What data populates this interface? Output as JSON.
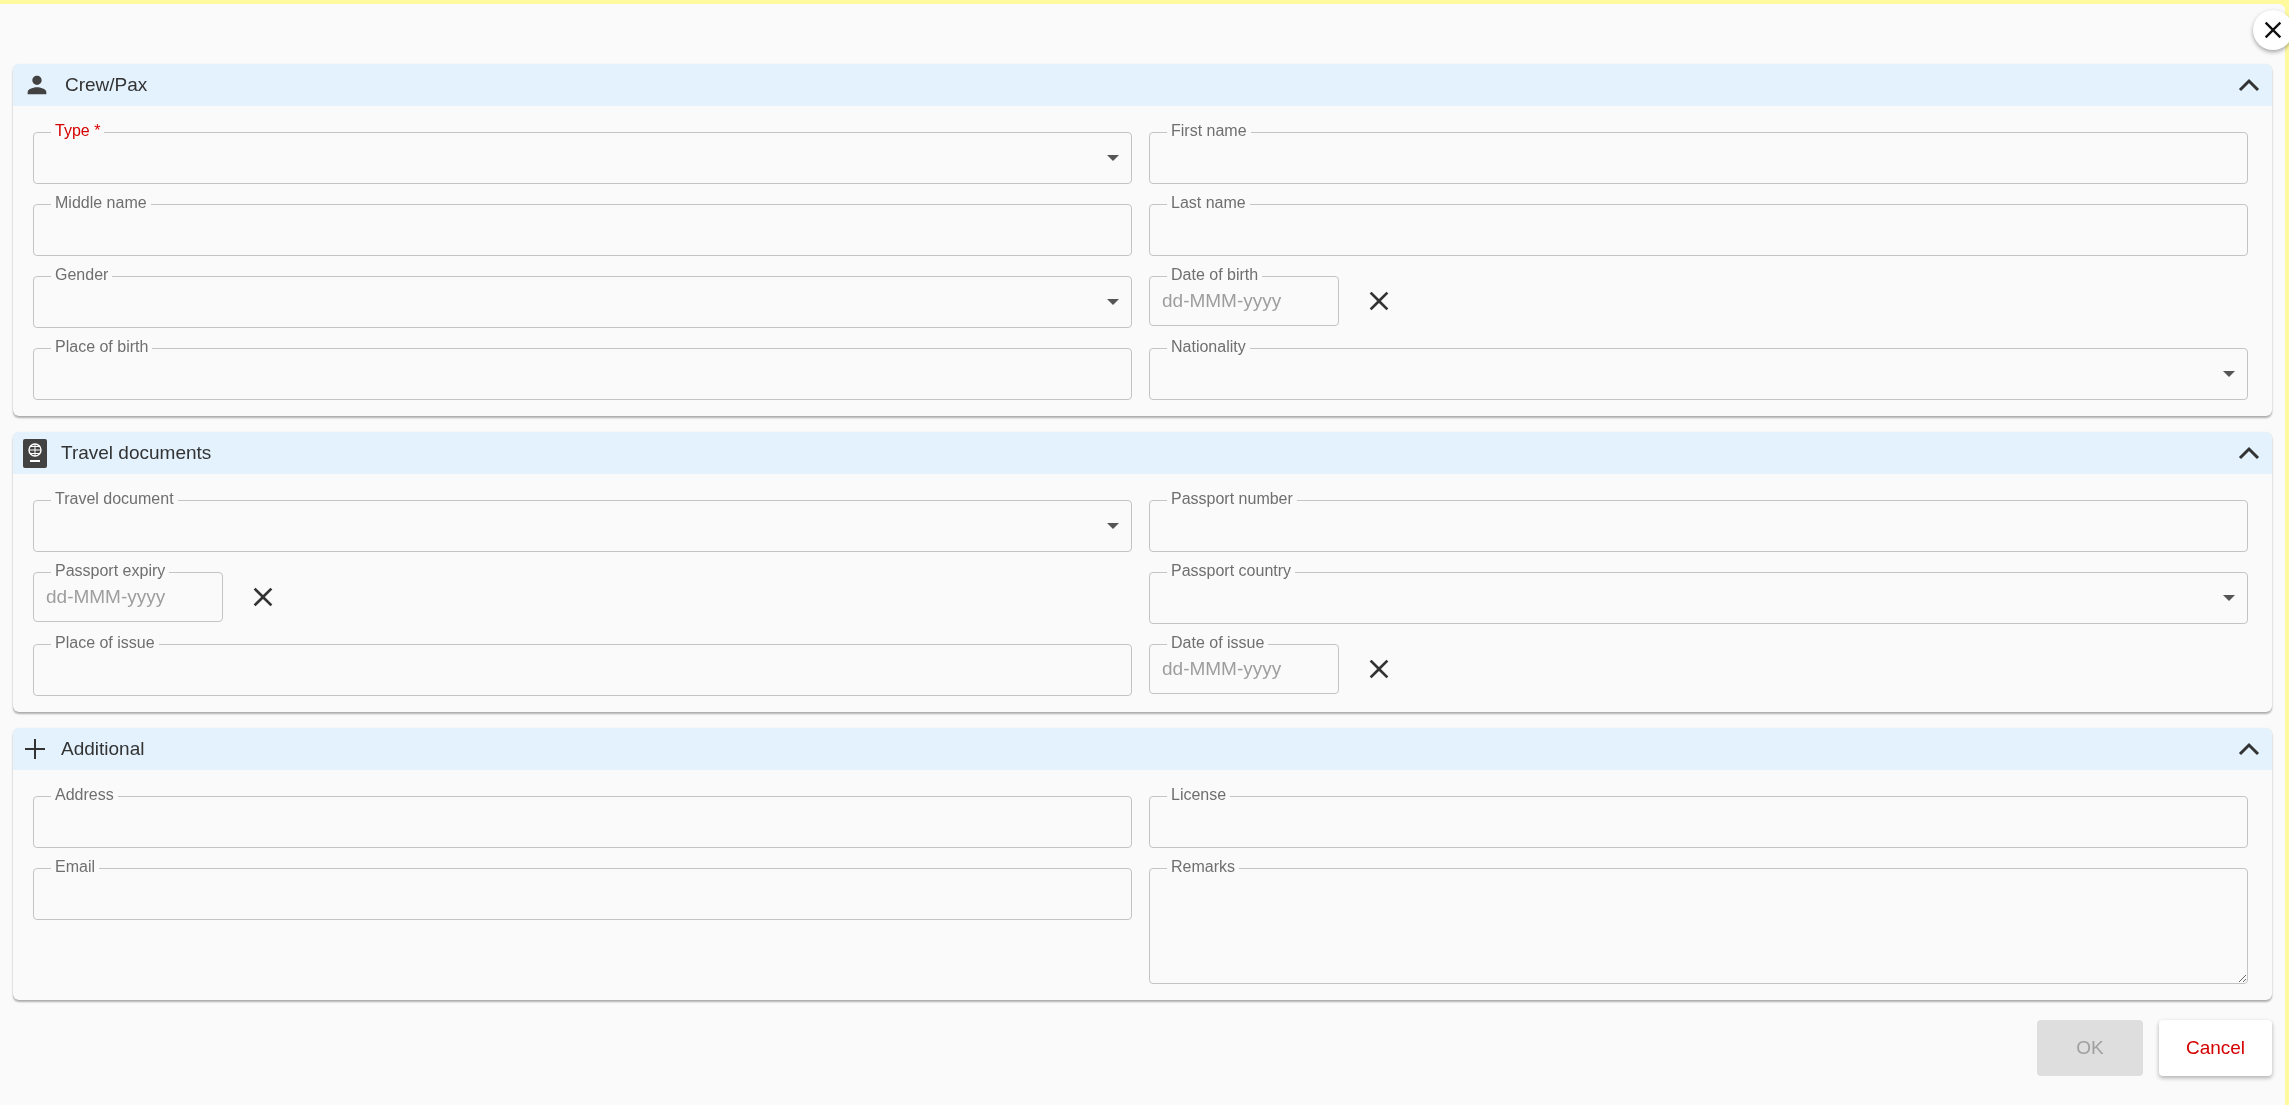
{
  "required_mark": "*",
  "sections": [
    {
      "title": "Crew/Pax",
      "expanded": true,
      "fields": [
        {
          "label": "Type",
          "kind": "select",
          "required": true
        },
        {
          "label": "First name",
          "kind": "text",
          "required": false
        },
        {
          "label": "Middle name",
          "kind": "text",
          "required": false
        },
        {
          "label": "Last name",
          "kind": "text",
          "required": false
        },
        {
          "label": "Gender",
          "kind": "select",
          "required": false
        },
        {
          "label": "Date of birth",
          "kind": "date",
          "required": false,
          "placeholder": "dd-MMM-yyyy"
        },
        {
          "label": "Place of birth",
          "kind": "text",
          "required": false
        },
        {
          "label": "Nationality",
          "kind": "select",
          "required": false
        }
      ]
    },
    {
      "title": "Travel documents",
      "expanded": true,
      "fields": [
        {
          "label": "Travel document",
          "kind": "select",
          "required": false
        },
        {
          "label": "Passport number",
          "kind": "text",
          "required": false
        },
        {
          "label": "Passport expiry",
          "kind": "date",
          "required": false,
          "placeholder": "dd-MMM-yyyy"
        },
        {
          "label": "Passport country",
          "kind": "select",
          "required": false
        },
        {
          "label": "Place of issue",
          "kind": "text",
          "required": false
        },
        {
          "label": "Date of issue",
          "kind": "date",
          "required": false,
          "placeholder": "dd-MMM-yyyy"
        }
      ]
    },
    {
      "title": "Additional",
      "expanded": true,
      "fields": [
        {
          "label": "Address",
          "kind": "text",
          "required": false
        },
        {
          "label": "License",
          "kind": "text",
          "required": false
        },
        {
          "label": "Email",
          "kind": "text",
          "required": false
        },
        {
          "label": "Remarks",
          "kind": "textarea",
          "required": false
        }
      ]
    }
  ],
  "buttons": [
    {
      "label": "OK",
      "disabled": true
    },
    {
      "label": "Cancel",
      "disabled": false
    }
  ]
}
